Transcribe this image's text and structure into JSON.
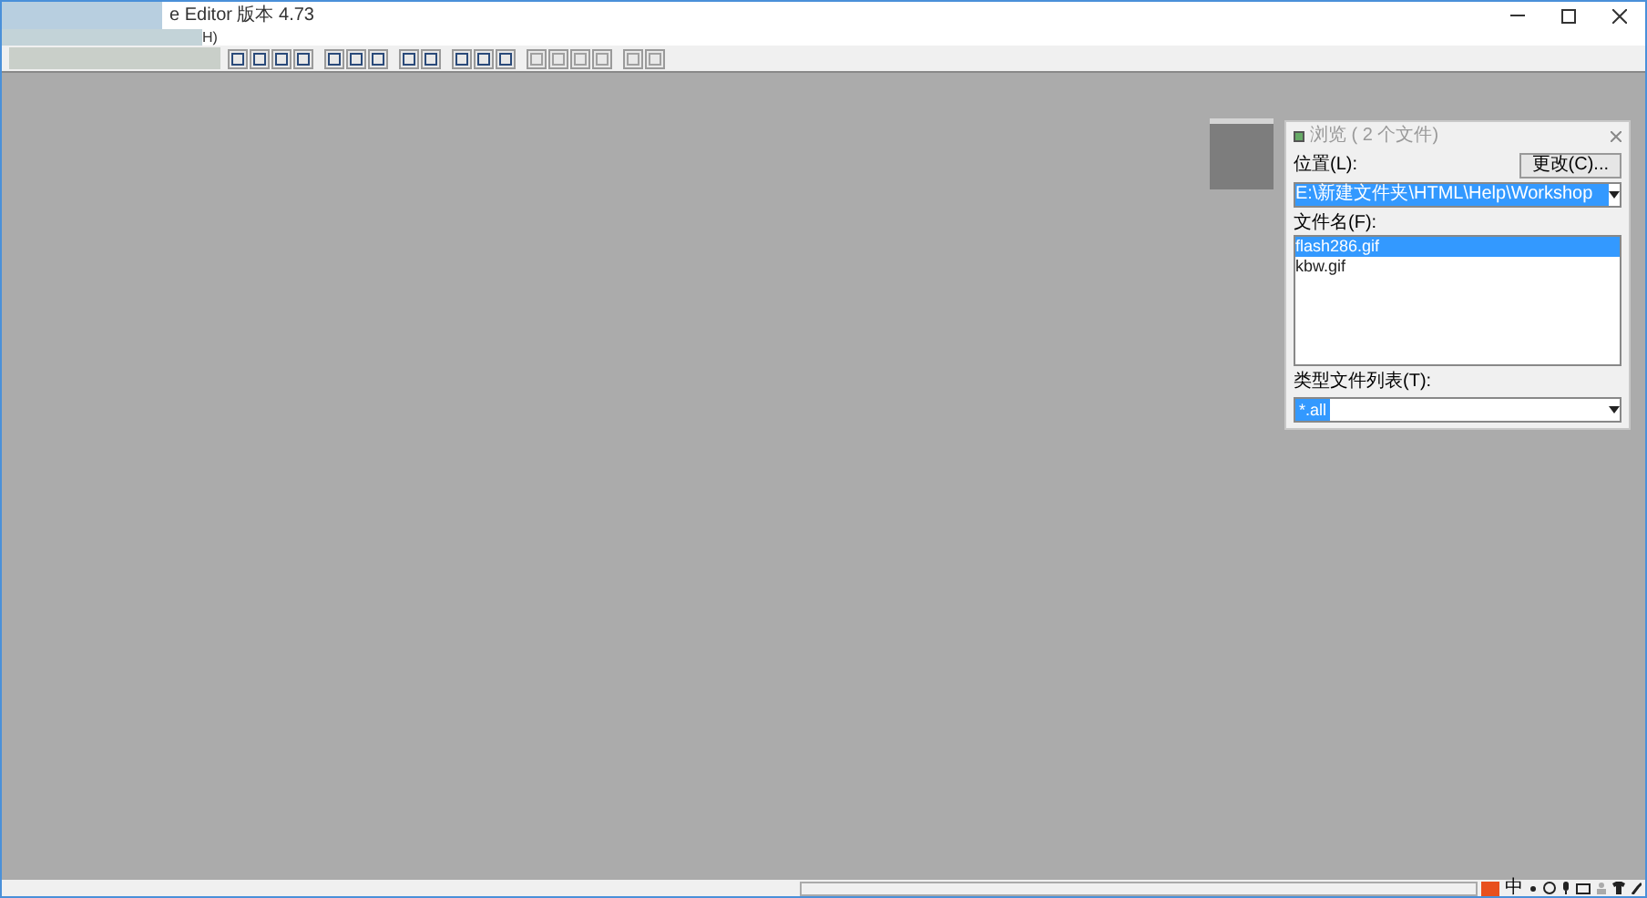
{
  "window": {
    "title": "e Editor 版本 4.73"
  },
  "menu": {
    "items": [
      "H)"
    ]
  },
  "toolbar": {
    "groups": [
      {
        "buttons": [
          {
            "disabled": false
          },
          {
            "disabled": false
          },
          {
            "disabled": false
          },
          {
            "disabled": false
          }
        ]
      },
      {
        "buttons": [
          {
            "disabled": false
          },
          {
            "disabled": false
          },
          {
            "disabled": false
          }
        ]
      },
      {
        "buttons": [
          {
            "disabled": false
          },
          {
            "disabled": false
          }
        ]
      },
      {
        "buttons": [
          {
            "disabled": false
          },
          {
            "disabled": false
          },
          {
            "disabled": false
          }
        ]
      },
      {
        "buttons": [
          {
            "disabled": true
          },
          {
            "disabled": true
          },
          {
            "disabled": true
          },
          {
            "disabled": true
          }
        ]
      },
      {
        "buttons": [
          {
            "disabled": true
          },
          {
            "disabled": true
          }
        ]
      }
    ]
  },
  "browse_dialog": {
    "title": "浏览 ( 2 个文件)",
    "location_label": "位置(L):",
    "change_button": "更改(C)...",
    "location_value": "E:\\新建文件夹\\HTML\\Help\\Workshop",
    "filename_label": "文件名(F):",
    "files": [
      {
        "name": "flash286.gif",
        "selected": true
      },
      {
        "name": "kbw.gif",
        "selected": false
      }
    ],
    "type_label": "类型文件列表(T):",
    "type_value": "*.all"
  },
  "tray": {
    "ime": "中"
  }
}
